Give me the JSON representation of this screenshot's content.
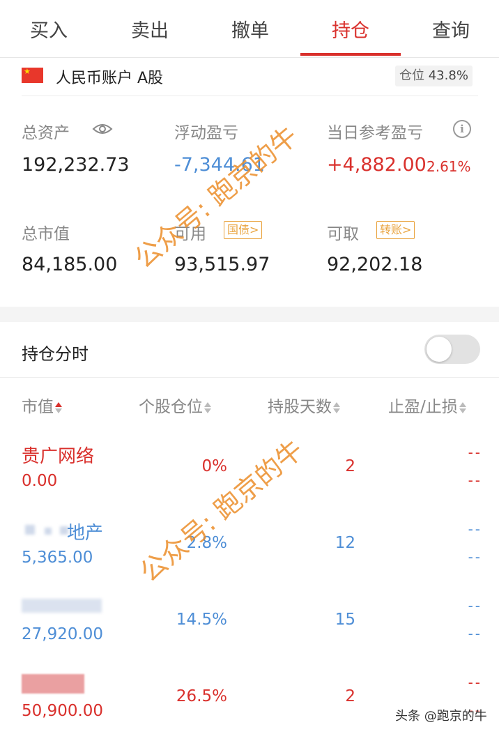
{
  "tabs": [
    "买入",
    "卖出",
    "撤单",
    "持仓",
    "查询"
  ],
  "active_tab": "持仓",
  "account": {
    "name": "人民币账户 A股",
    "position_label": "仓位",
    "position_value": "43.8%"
  },
  "summary": {
    "total_assets": {
      "label": "总资产",
      "value": "192,232.73"
    },
    "floating_pl": {
      "label": "浮动盈亏",
      "value": "-7,344.61"
    },
    "daily_pl": {
      "label": "当日参考盈亏",
      "value": "+4,882.00",
      "pct": "2.61%"
    },
    "market_value": {
      "label": "总市值",
      "value": "84,185.00"
    },
    "available": {
      "label": "可用",
      "tag": "国债>",
      "value": "93,515.97"
    },
    "withdrawable": {
      "label": "可取",
      "tag": "转账>",
      "value": "92,202.18"
    }
  },
  "timeshare": {
    "label": "持仓分时",
    "enabled": false
  },
  "columns": [
    "市值",
    "个股仓位",
    "持股天数",
    "止盈/止损"
  ],
  "holdings": [
    {
      "name": "贵广网络",
      "value": "0.00",
      "position": "0%",
      "days": "2",
      "tp": "--",
      "sl": "--",
      "color": "red"
    },
    {
      "name": "地产",
      "value": "5,365.00",
      "position": "2.8%",
      "days": "12",
      "tp": "--",
      "sl": "--",
      "color": "blue"
    },
    {
      "name": "",
      "value": "27,920.00",
      "position": "14.5%",
      "days": "15",
      "tp": "--",
      "sl": "--",
      "color": "blue"
    },
    {
      "name": "",
      "value": "50,900.00",
      "position": "26.5%",
      "days": "2",
      "tp": "--",
      "sl": "--",
      "color": "red"
    }
  ],
  "watermark": "公众号: 跑京的牛",
  "footer_mark": "头条 @跑京的牛",
  "colors": {
    "accent": "#d9302c",
    "blue": "#4e8ed6",
    "tag": "#e9a23b",
    "watermark": "#ec8e2a"
  }
}
